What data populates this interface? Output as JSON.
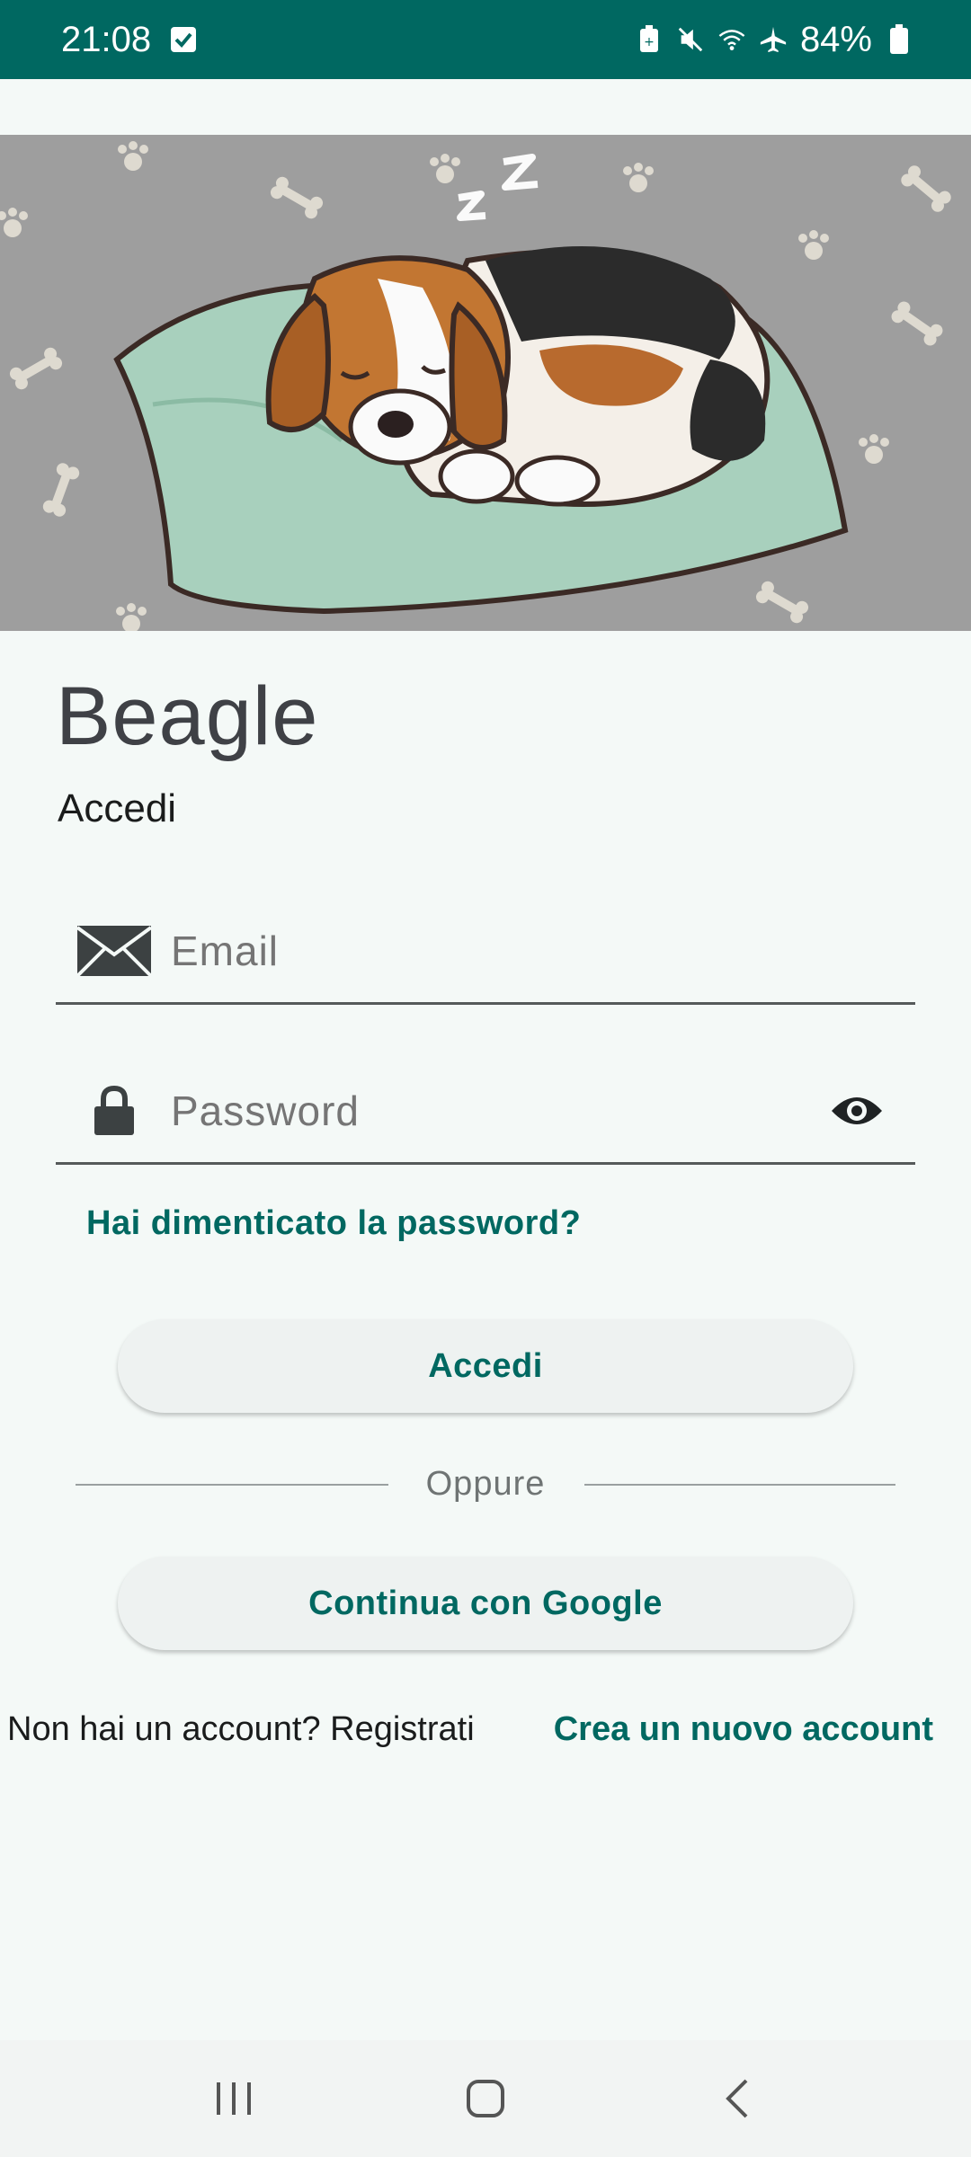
{
  "status_bar": {
    "time": "21:08",
    "battery": "84%",
    "icons": [
      "check-box-icon",
      "battery-saver-icon",
      "mute-icon",
      "wifi-icon",
      "airplane-icon",
      "battery-icon"
    ]
  },
  "app": {
    "title": "Beagle",
    "subtitle": "Accedi"
  },
  "form": {
    "email_placeholder": "Email",
    "password_placeholder": "Password",
    "forgot_password": "Hai dimenticato la password?",
    "login_button": "Accedi",
    "divider_text": "Oppure",
    "google_button": "Continua con Google",
    "signup_prompt": "Non hai un account? Registrati",
    "signup_link": "Crea un nuovo account"
  },
  "colors": {
    "accent": "#006861",
    "background": "#f4f9f7",
    "button_bg": "#eef2f1"
  },
  "nav_bar": {
    "icons": [
      "recent-apps-icon",
      "home-icon",
      "back-icon"
    ]
  }
}
